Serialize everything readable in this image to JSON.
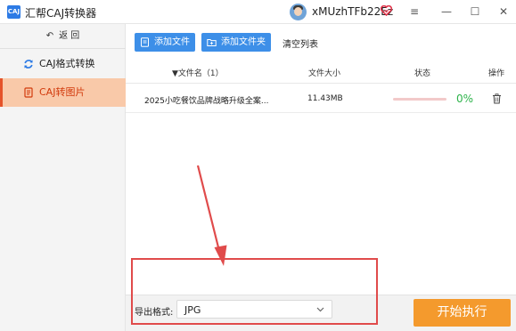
{
  "window": {
    "title": "汇帮CAJ转换器",
    "logo_text": "CAJ",
    "username": "xMUzhTFb22Ez",
    "controls": {
      "menu": "≡",
      "minimize": "—",
      "maximize": "☐",
      "close": "✕"
    }
  },
  "sidebar": {
    "back_label": "返 回",
    "items": [
      {
        "label": "CAJ格式转换",
        "icon": "refresh-icon",
        "active": false
      },
      {
        "label": "CAJ转图片",
        "icon": "document-icon",
        "active": true
      }
    ]
  },
  "toolbar": {
    "add_file_label": "添加文件",
    "add_folder_label": "添加文件夹",
    "clear_label": "清空列表"
  },
  "table": {
    "headers": {
      "filename": "▼文件名（1）",
      "size": "文件大小",
      "status": "状态",
      "action": "操作"
    },
    "rows": [
      {
        "filename": "2025小吃餐饮品牌战略升级全案...",
        "size": "11.43MB",
        "progress_percent": 0,
        "percent_text": "0%"
      }
    ]
  },
  "footer": {
    "format_label": "导出格式:",
    "format_value": "JPG",
    "start_label": "开始执行"
  },
  "colors": {
    "accent_blue": "#3d8fe8",
    "active_bg": "#f9c9a9",
    "active_text": "#d23a0c",
    "start_orange": "#f49a2d",
    "annotation_red": "#e04b4b",
    "progress_green": "#2db34a"
  }
}
